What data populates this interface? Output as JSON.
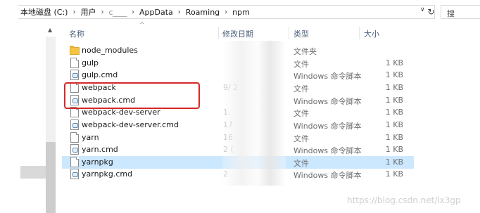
{
  "address": {
    "crumbs": [
      "本地磁盘 (C:)",
      "用户",
      "c____",
      "AppData",
      "Roaming",
      "npm"
    ],
    "search_placeholder": "搜"
  },
  "columns": {
    "name": "名称",
    "date": "修改日期",
    "type": "类型",
    "size": "大小"
  },
  "rows": [
    {
      "name": "node_modules",
      "icon": "folder-icon",
      "date": "",
      "type": "文件夹",
      "size": ""
    },
    {
      "name": "gulp",
      "icon": "file-icon",
      "date": "",
      "type": "文件",
      "size": "1 KB"
    },
    {
      "name": "gulp.cmd",
      "icon": "cmd-icon",
      "date": "",
      "type": "Windows 命令脚本",
      "size": "1 KB"
    },
    {
      "name": "webpack",
      "icon": "file-icon",
      "date": "9/ 2",
      "type": "文件",
      "size": "1 KB"
    },
    {
      "name": "webpack.cmd",
      "icon": "cmd-icon",
      "date": "",
      "type": "Windows 命令脚本",
      "size": "1 KB"
    },
    {
      "name": "webpack-dev-server",
      "icon": "file-icon",
      "date": "1.",
      "type": "文件",
      "size": "1 KB"
    },
    {
      "name": "webpack-dev-server.cmd",
      "icon": "cmd-icon",
      "date": "17",
      "type": "Windows 命令脚本",
      "size": "1 KB"
    },
    {
      "name": "yarn",
      "icon": "file-icon",
      "date": "16",
      "type": "文件",
      "size": "1 KB"
    },
    {
      "name": "yarn.cmd",
      "icon": "cmd-icon",
      "date": "2 (",
      "type": "Windows 命令脚本",
      "size": "1 KB"
    },
    {
      "name": "yarnpkg",
      "icon": "file-icon",
      "date": "",
      "type": "文件",
      "size": "1 KB"
    },
    {
      "name": "yarnpkg.cmd",
      "icon": "cmd-icon",
      "date": "2",
      "type": "Windows 命令脚本",
      "size": "1 KB"
    }
  ],
  "selected_row": 9,
  "watermark": "https://blog.csdn.net/lx3gp",
  "colors": {
    "highlight": "#d62828",
    "selection": "#cce8ff",
    "header_text": "#4c607a"
  }
}
